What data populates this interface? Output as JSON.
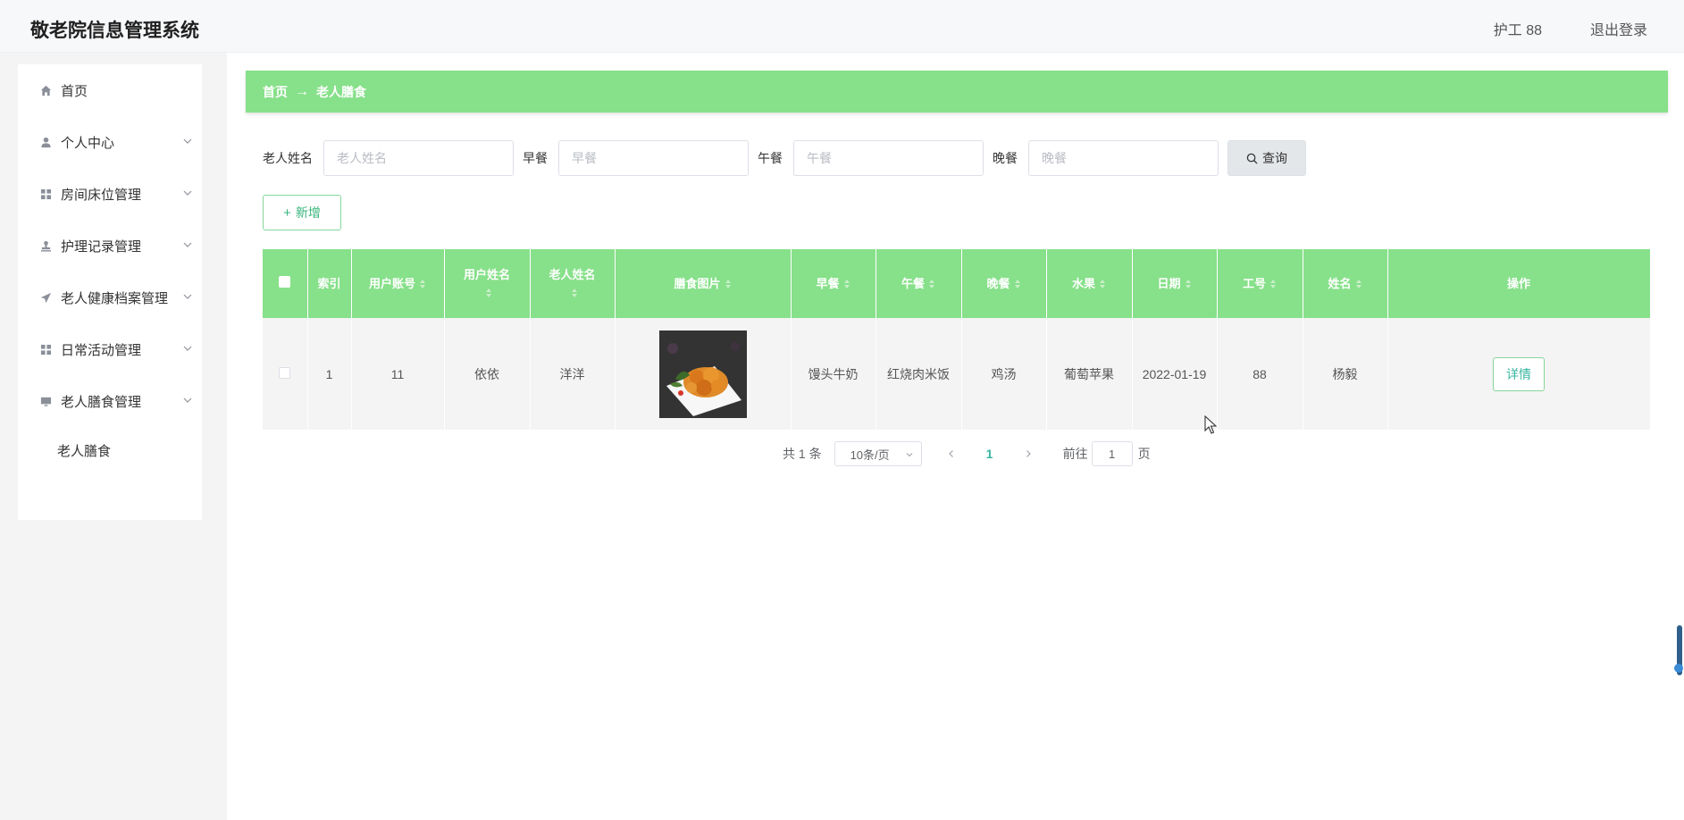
{
  "app": {
    "title": "敬老院信息管理系统",
    "user": "护工 88",
    "logout": "退出登录"
  },
  "sidebar": {
    "items": [
      {
        "label": "首页",
        "icon": "home-icon"
      },
      {
        "label": "个人中心",
        "icon": "user-icon"
      },
      {
        "label": "房间床位管理",
        "icon": "grid-icon"
      },
      {
        "label": "护理记录管理",
        "icon": "stamp-icon"
      },
      {
        "label": "老人健康档案管理",
        "icon": "paper-plane-icon"
      },
      {
        "label": "日常活动管理",
        "icon": "grid-icon"
      },
      {
        "label": "老人膳食管理",
        "icon": "monitor-icon"
      }
    ],
    "subitem": "老人膳食"
  },
  "breadcrumb": {
    "home": "首页",
    "arrow": "→",
    "current": "老人膳食"
  },
  "search": {
    "fields": [
      {
        "label": "老人姓名",
        "placeholder": "老人姓名"
      },
      {
        "label": "早餐",
        "placeholder": "早餐"
      },
      {
        "label": "午餐",
        "placeholder": "午餐"
      },
      {
        "label": "晚餐",
        "placeholder": "晚餐"
      }
    ],
    "button": "查询"
  },
  "add_button": "新增",
  "table": {
    "columns": [
      "索引",
      "用户账号",
      "用户姓名",
      "老人姓名",
      "膳食图片",
      "早餐",
      "午餐",
      "晚餐",
      "水果",
      "日期",
      "工号",
      "姓名",
      "操作"
    ],
    "rows": [
      {
        "index": "1",
        "account": "11",
        "username": "依依",
        "elder": "洋洋",
        "breakfast": "馒头牛奶",
        "lunch": "红烧肉米饭",
        "dinner": "鸡汤",
        "fruit": "葡萄苹果",
        "date": "2022-01-19",
        "staff_id": "88",
        "name": "杨毅",
        "action": "详情"
      }
    ]
  },
  "pagination": {
    "total": "共 1 条",
    "page_size": "10条/页",
    "current": "1",
    "goto_label": "前往",
    "goto_value": "1",
    "page_suffix": "页"
  },
  "colors": {
    "accent_green": "#87e08a",
    "text_green": "#37b5a0"
  }
}
